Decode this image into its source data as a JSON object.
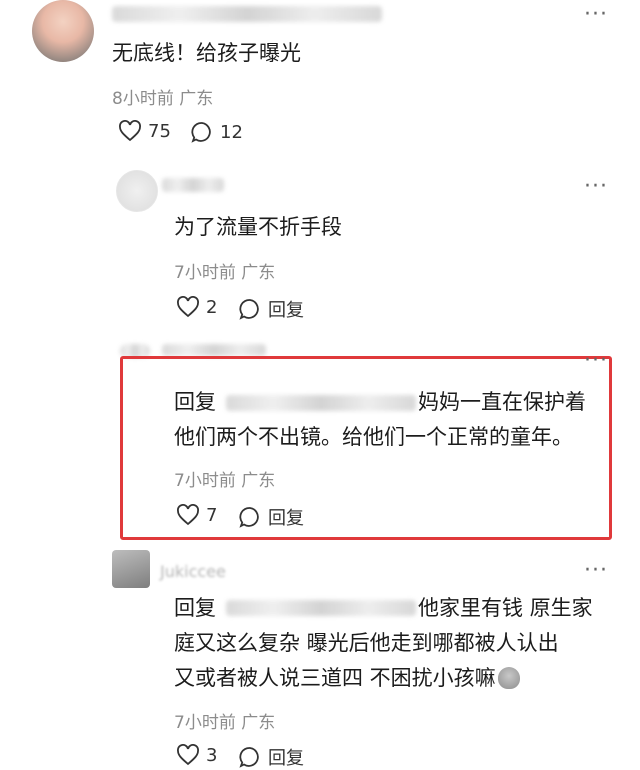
{
  "comments": [
    {
      "text": "无底线！给孩子曝光",
      "meta": "8小时前  广东",
      "likes": "75",
      "replies": "12"
    },
    {
      "text": "为了流量不折手段",
      "meta": "7小时前  广东",
      "likes": "2",
      "reply_label": "回复"
    },
    {
      "prefix": "回复",
      "line1_tail": "妈妈一直在保护着",
      "line2": "他们两个不出镜。给他们一个正常的童年。",
      "meta": "7小时前  广东",
      "likes": "7",
      "reply_label": "回复"
    },
    {
      "username": "Jukiccee",
      "prefix": "回复",
      "line1_tail": "他家里有钱  原生家",
      "line2": "庭又这么复杂  曝光后他走到哪都被人认出",
      "line3": "又或者被人说三道四  不困扰小孩嘛",
      "meta": "7小时前  广东",
      "likes": "3",
      "reply_label": "回复"
    }
  ],
  "more_symbol": "···",
  "colors": {
    "highlight_border": "#e0393b",
    "meta_text": "#8c8c8c"
  },
  "icons": [
    "heart-icon",
    "comment-bubble-icon",
    "more-icon",
    "avatar"
  ]
}
